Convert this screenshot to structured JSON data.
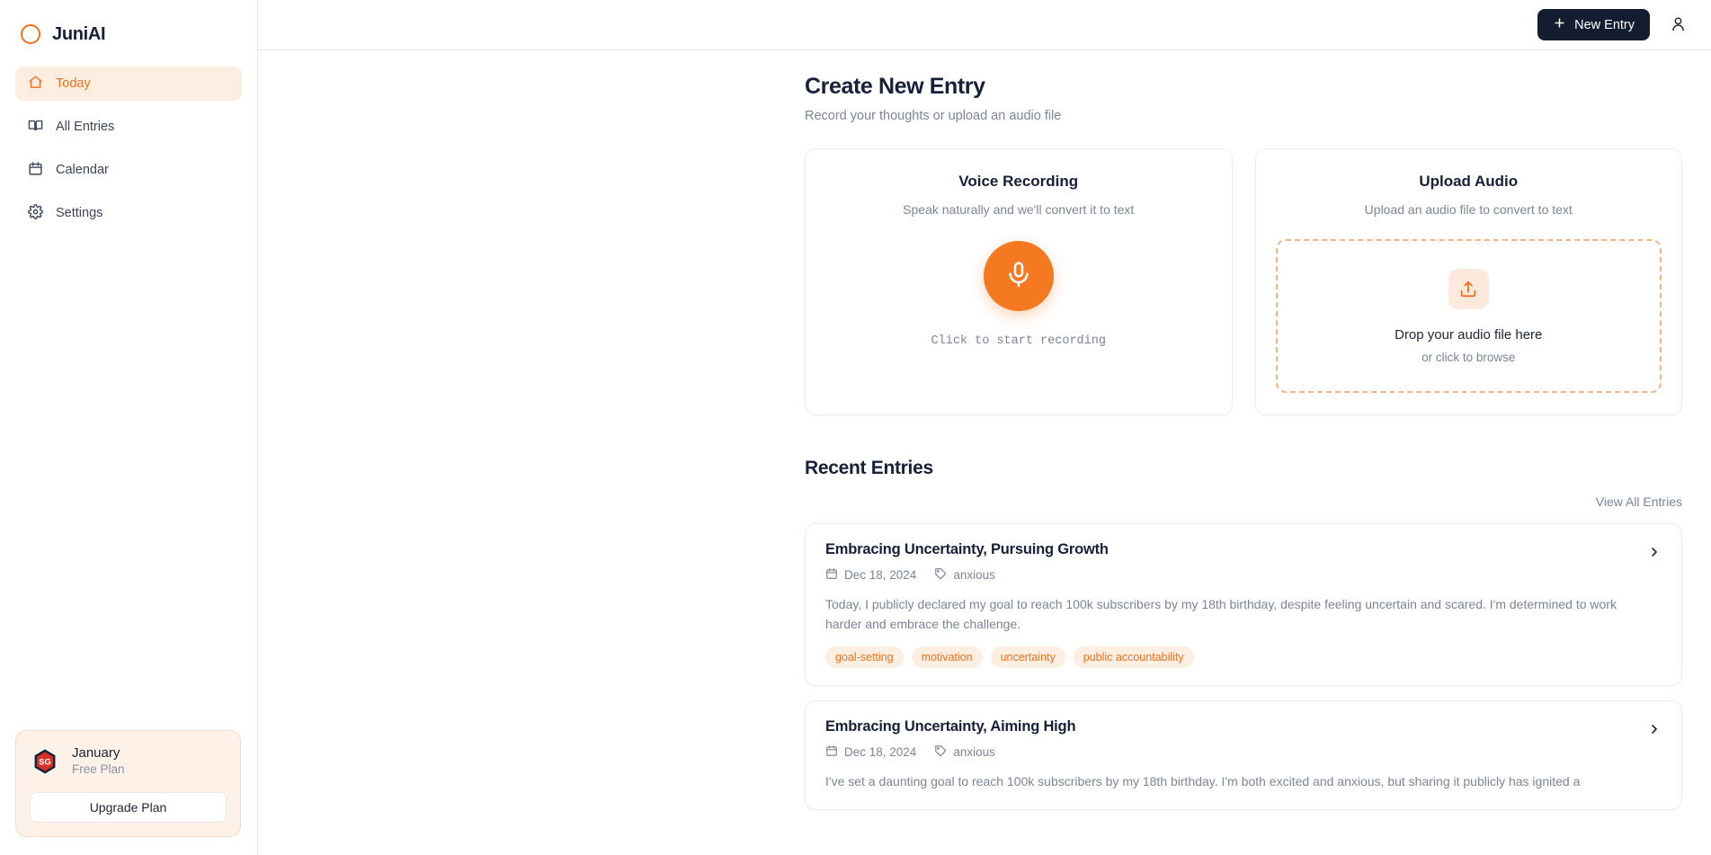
{
  "brand": {
    "name": "JuniAI",
    "logo_icon": "circle-ring-icon",
    "accent_color": "#f2711c"
  },
  "sidebar": {
    "items": [
      {
        "label": "Today",
        "icon": "home-icon",
        "active": true
      },
      {
        "label": "All Entries",
        "icon": "book-open-icon",
        "active": false
      },
      {
        "label": "Calendar",
        "icon": "calendar-icon",
        "active": false
      },
      {
        "label": "Settings",
        "icon": "gear-icon",
        "active": false
      }
    ],
    "plan": {
      "badge_icon": "hexagon-sg-badge-icon",
      "badge_text": "SG",
      "name": "January",
      "tier": "Free Plan",
      "upgrade_label": "Upgrade Plan"
    }
  },
  "topbar": {
    "new_entry_label": "New Entry",
    "new_entry_icon": "plus-icon",
    "account_icon": "user-icon",
    "button_color": "#141c30"
  },
  "main": {
    "title": "Create New Entry",
    "subtitle": "Record your thoughts or upload an audio file",
    "voice_card": {
      "title": "Voice Recording",
      "subtitle": "Speak naturally and we'll convert it to text",
      "mic_icon": "microphone-icon",
      "hint": "Click to start recording",
      "button_color": "#f57920"
    },
    "upload_card": {
      "title": "Upload Audio",
      "subtitle": "Upload an audio file to convert to text",
      "upload_icon": "upload-icon",
      "drop_title": "Drop your audio file here",
      "drop_subtitle": "or click to browse",
      "border_color": "#f6b27f"
    },
    "recent": {
      "heading": "Recent Entries",
      "view_all_label": "View All Entries",
      "entries": [
        {
          "title": "Embracing Uncertainty, Pursuing Growth",
          "date": "Dec 18, 2024",
          "mood": "anxious",
          "date_icon": "calendar-icon",
          "mood_icon": "tag-icon",
          "chevron_icon": "chevron-right-icon",
          "excerpt": "Today, I publicly declared my goal to reach 100k subscribers by my 18th birthday, despite feeling uncertain and scared. I'm determined to work harder and embrace the challenge.",
          "tags": [
            "goal-setting",
            "motivation",
            "uncertainty",
            "public accountability"
          ]
        },
        {
          "title": "Embracing Uncertainty, Aiming High",
          "date": "Dec 18, 2024",
          "mood": "anxious",
          "date_icon": "calendar-icon",
          "mood_icon": "tag-icon",
          "chevron_icon": "chevron-right-icon",
          "excerpt": "I've set a daunting goal to reach 100k subscribers by my 18th birthday. I'm both excited and anxious, but sharing it publicly has ignited a",
          "tags": []
        }
      ]
    }
  }
}
